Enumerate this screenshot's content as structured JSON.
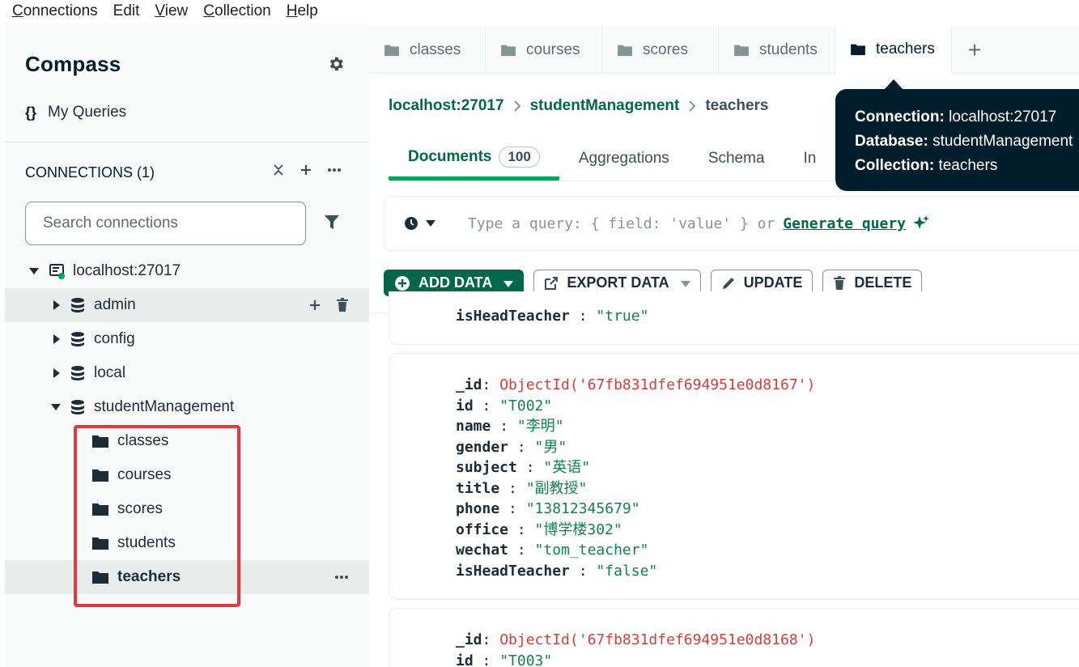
{
  "menubar": {
    "items": [
      {
        "first": "C",
        "rest": "onnections"
      },
      {
        "first": "E",
        "rest": "dit"
      },
      {
        "first": "V",
        "rest": "iew"
      },
      {
        "first": "C",
        "rest": "ollection"
      },
      {
        "first": "H",
        "rest": "elp"
      }
    ]
  },
  "sidebar": {
    "title": "Compass",
    "my_queries_icon": "{}",
    "my_queries": "My Queries",
    "connections_label": "CONNECTIONS",
    "connections_count": "(1)",
    "search_placeholder": "Search connections",
    "connection_name": "localhost:27017",
    "databases": [
      "admin",
      "config",
      "local",
      "studentManagement"
    ],
    "collections": [
      "classes",
      "courses",
      "scores",
      "students",
      "teachers"
    ]
  },
  "tabs": [
    "classes",
    "courses",
    "scores",
    "students",
    "teachers"
  ],
  "tab_add": "+",
  "breadcrumb": {
    "host": "localhost:27017",
    "db": "studentManagement",
    "collection": "teachers"
  },
  "subtabs": {
    "documents": "Documents",
    "documents_count": "100",
    "aggregations": "Aggregations",
    "schema": "Schema",
    "indexes_partial": "In"
  },
  "query": {
    "placeholder": "Type a query: { field: 'value' } or",
    "generate": "Generate query"
  },
  "toolbar": {
    "add": "ADD DATA",
    "export": "EXPORT DATA",
    "update": "UPDATE",
    "delete": "DELETE"
  },
  "tooltip": {
    "conn_key": "Connection:",
    "conn_val": "localhost:27017",
    "db_key": "Database:",
    "db_val": "studentManagement",
    "coll_key": "Collection:",
    "coll_val": "teachers"
  },
  "documents": {
    "partial_prev": {
      "key": "isHeadTeacher",
      "value": "\"true\""
    },
    "doc2": [
      {
        "key": "_id",
        "value": "ObjectId('67fb831dfef694951e0d8167')",
        "type": "oid"
      },
      {
        "key": "id",
        "value": "\"T002\""
      },
      {
        "key": "name",
        "value": "\"李明\""
      },
      {
        "key": "gender",
        "value": "\"男\""
      },
      {
        "key": "subject",
        "value": "\"英语\""
      },
      {
        "key": "title",
        "value": "\"副教授\""
      },
      {
        "key": "phone",
        "value": "\"13812345679\""
      },
      {
        "key": "office",
        "value": "\"博学楼302\""
      },
      {
        "key": "wechat",
        "value": "\"tom_teacher\""
      },
      {
        "key": "isHeadTeacher",
        "value": "\"false\""
      }
    ],
    "doc3": [
      {
        "key": "_id",
        "value": "ObjectId('67fb831dfef694951e0d8168')",
        "type": "oid"
      },
      {
        "key": "id",
        "value": "\"T003\""
      }
    ]
  },
  "colors": {
    "accent": "#00684a",
    "brand_green": "#00a35c",
    "tooltip_bg": "#001e2b",
    "highlight_box": "#e4373e"
  }
}
